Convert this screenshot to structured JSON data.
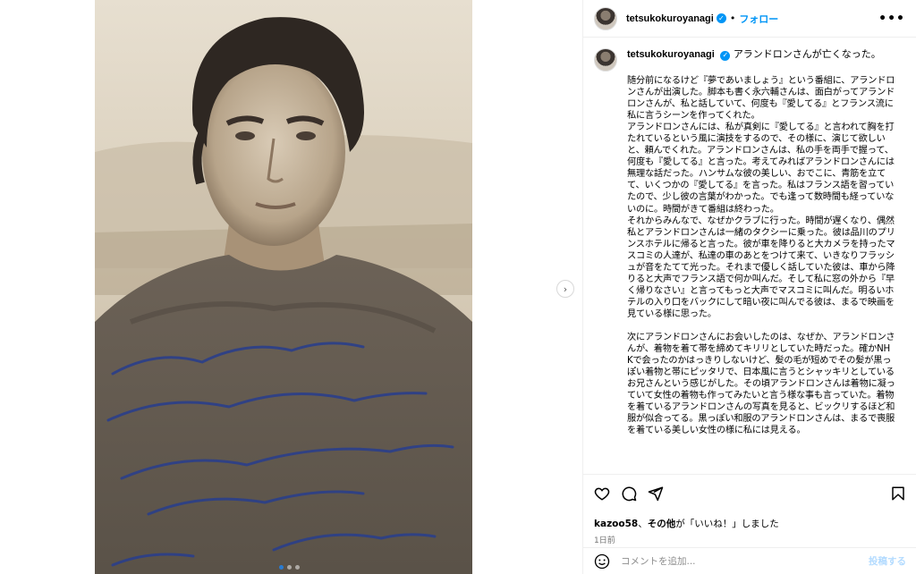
{
  "post": {
    "photo": {
      "handwriting_lines": [
        "To Kuroyanagi",
        "unfortunately I haven't",
        "known you long enough",
        "May be Next time.",
        "June 13/64",
        "alaindelon"
      ]
    },
    "carousel": {
      "total": 3,
      "active": 1
    }
  },
  "header": {
    "username": "tetsukokuroyanagi",
    "verified_icon": "✓",
    "separator": "•",
    "follow_label": "フォロー",
    "more_label": "•••"
  },
  "caption": {
    "username": "tetsukokuroyanagi",
    "title": "アランドロンさんが亡くなった。",
    "paragraphs": [
      "随分前になるけど『夢であいましょう』という番組に、アランドロンさんが出演した。脚本も書く永六輔さんは、面白がってアランドロンさんが、私と話していて、何度も『愛してる』とフランス流に私に言うシーンを作ってくれた。",
      "アランドロンさんには、私が真剣に『愛してる』と言われて胸を打たれているという風に演技をするので、その様に、演じて欲しいと、頼んでくれた。アランドロンさんは、私の手を両手で握って、何度も『愛してる』と言った。考えてみればアランドロンさんには無理な話だった。ハンサムな彼の美しい、おでこに、青筋を立てて、いくつかの『愛してる』を言った。私はフランス語を習っていたので、少し彼の言葉がわかった。でも逢って数時間も経っていないのに。時間がきて番組は終わった。",
      "それからみんなで、なぜかクラブに行った。時間が遅くなり、偶然私とアランドロンさんは一緒のタクシーに乗った。彼は品川のプリンスホテルに帰ると言った。彼が車を降りると大カメラを持ったマスコミの人達が、私達の車のあとをつけて来て、いきなりフラッシュが音をたてて光った。それまで優しく話していた彼は、車から降りると大声でフランス語で何か叫んだ。そして私に窓の外から『早く帰りなさい』と言ってもっと大声でマスコミに叫んだ。明るいホテルの入り口をバックにして暗い夜に叫んでる彼は、まるで映画を見ている様に思った。",
      "",
      "次にアランドロンさんにお会いしたのは、なぜか、アランドロンさんが、着物を着て帯を締めてキリリとしていた時だった。確かNHKで会ったのかはっきりしないけど、髪の毛が短めでその髪が黒っぽい着物と帯にピッタリで、日本風に言うとシャッキリとしているお兄さんという感じがした。その頃アランドロンさんは着物に凝っていて女性の着物も作ってみたいと言う様な事も言っていた。着物を着ているアランドロンさんの写真を見ると、ビックリするほど和服が似合ってる。黒っぽい和服のアランドロンさんは、まるで喪服を着ている美しい女性の様に私には見える。"
    ]
  },
  "actions": {
    "like_icon": "heart-icon",
    "comment_icon": "comment-icon",
    "share_icon": "share-icon",
    "save_icon": "bookmark-icon"
  },
  "likes": {
    "user": "kazoo58",
    "connector": "、",
    "others": "その他",
    "suffix": "が「いいね！」しました"
  },
  "timestamp": "1日前",
  "comment": {
    "placeholder": "コメントを追加...",
    "post_label": "投稿する"
  },
  "next_label": "›"
}
